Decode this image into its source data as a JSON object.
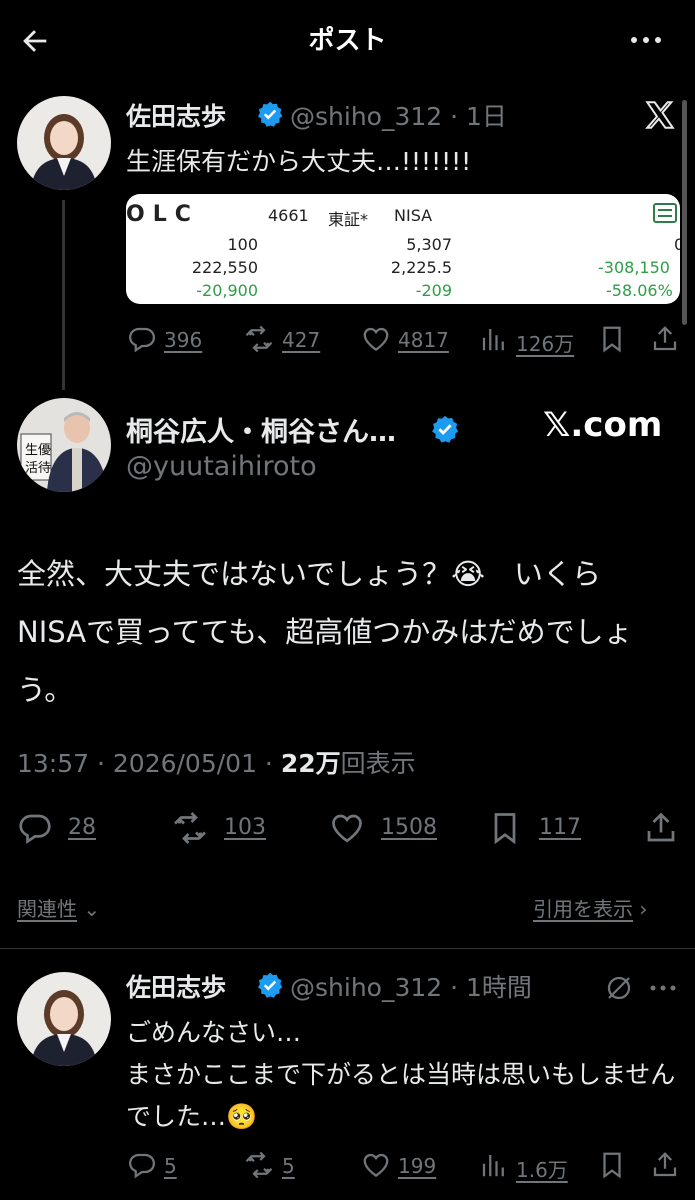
{
  "header": {
    "title": "ポスト"
  },
  "quoted_post": {
    "author_name": "佐田志歩",
    "handle_time": "@shiho_312 · 1日",
    "text": "生涯保有だから大丈夫…!!!!!!!",
    "card": {
      "ticker": "OLC",
      "code": "4661",
      "market": "東証*",
      "account": "NISA",
      "row1": [
        "100",
        "5,307",
        "0"
      ],
      "row2": [
        "222,550",
        "2,225.5",
        "-308,150"
      ],
      "row3": [
        "-20,900",
        "-209",
        "-58.06%"
      ]
    },
    "stats": {
      "replies": "396",
      "reposts": "427",
      "likes": "4817",
      "views": "126万"
    }
  },
  "main_post": {
    "author_name": "桐谷広人・桐谷さん…",
    "handle": "@yuutaihiroto",
    "source": "𝕏.com",
    "text": "全然、大丈夫ではないでしょう？😭　いくら　NISAで買ってても、超高値つかみはだめでしょう。",
    "time": "13:57 · 2026/05/01 · ",
    "views_count": "22万",
    "views_label": "回表示",
    "stats": {
      "replies": "28",
      "reposts": "103",
      "likes": "1508",
      "bookmarks": "117"
    }
  },
  "sort": {
    "related_label": "関連性",
    "quotes_label": "引用を表示"
  },
  "reply_post": {
    "author_name": "佐田志歩",
    "handle_time": "@shiho_312 · 1時間",
    "text": "ごめんなさい…\nまさかここまで下がるとは当時は思いもしませんでした…🥺",
    "stats": {
      "replies": "5",
      "reposts": "5",
      "likes": "199",
      "views": "1.6万"
    }
  },
  "colors": {
    "background": "#000000",
    "text": "#e7e9ea",
    "muted": "#71767b",
    "verified": "#1d9bf0",
    "gain_loss": "#2e9e48"
  }
}
